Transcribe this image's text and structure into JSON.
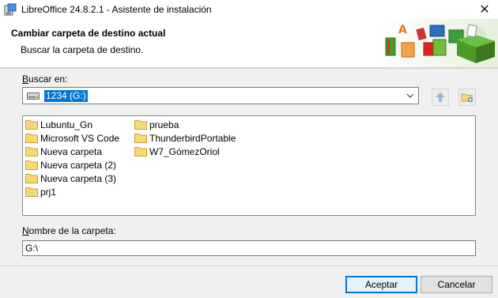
{
  "window": {
    "title": "LibreOffice 24.8.2.1 - Asistente de instalación",
    "close_symbol": "✕"
  },
  "header": {
    "title": "Cambiar carpeta de destino actual",
    "subtitle": "Buscar la carpeta de destino."
  },
  "lookin": {
    "label_accel": "B",
    "label_rest": "uscar en:",
    "selected": "1234 (G:)",
    "arrow": "⌵"
  },
  "folders": {
    "col1": [
      "Lubuntu_Gn",
      "Microsoft VS Code",
      "Nueva carpeta",
      "Nueva carpeta (2)",
      "Nueva carpeta (3)",
      "prj1"
    ],
    "col2": [
      "prueba",
      "ThunderbirdPortable",
      "W7_GómezOriol"
    ]
  },
  "foldername": {
    "label_accel": "N",
    "label_rest": "ombre de la carpeta:",
    "value": "G:\\"
  },
  "buttons": {
    "accept": "Aceptar",
    "cancel": "Cancelar"
  },
  "colors": {
    "accent": "#0078d7",
    "folder": "#f8d775"
  }
}
